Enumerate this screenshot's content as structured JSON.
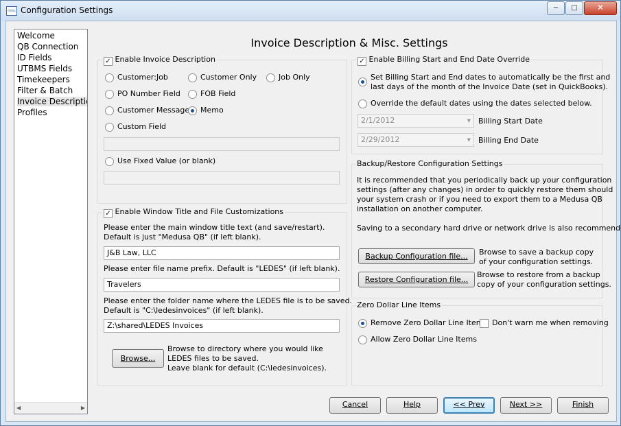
{
  "window": {
    "title": "Configuration Settings",
    "icon_text": "misc",
    "minimize": "−",
    "maximize": "□",
    "close": "✕"
  },
  "nav": {
    "items": [
      {
        "label": "Welcome"
      },
      {
        "label": "QB Connection"
      },
      {
        "label": "ID Fields"
      },
      {
        "label": "UTBMS Fields"
      },
      {
        "label": "Timekeepers"
      },
      {
        "label": "Filter & Batch"
      },
      {
        "label": "Invoice Description"
      },
      {
        "label": "Profiles"
      }
    ],
    "selected_index": 6,
    "scroll_left": "◀",
    "scroll_right": "▶"
  },
  "page_title": "Invoice Description & Misc. Settings",
  "invoice_desc": {
    "enable_label": "Enable Invoice Description",
    "enabled": true,
    "options": {
      "customer_job": "Customer:Job",
      "customer_only": "Customer Only",
      "job_only": "Job Only",
      "po_number": "PO Number Field",
      "fob": "FOB Field",
      "customer_message": "Customer Message",
      "memo": "Memo",
      "custom_field": "Custom Field",
      "fixed_value": "Use Fixed Value (or blank)"
    },
    "selected": "memo",
    "custom_field_value": "",
    "fixed_value": ""
  },
  "window_title": {
    "enable_label": "Enable Window Title and File Customizations",
    "enabled": true,
    "title_prompt_1": "Please enter the main window title text (and save/restart).",
    "title_prompt_2": "Default is just \"Medusa QB\" (if left blank).",
    "title_value": "J&B Law, LLC",
    "prefix_prompt": "Please enter file name prefix. Default is \"LEDES\" (if left blank).",
    "prefix_value": "Travelers",
    "folder_prompt_1": "Please enter the folder name where the LEDES file is to be saved.",
    "folder_prompt_2": "Default is \"C:\\ledesinvoices\" (if left blank).",
    "folder_value": "Z:\\shared\\LEDES Invoices",
    "browse_label": "Browse...",
    "browse_help_1": "Browse to directory where you would like",
    "browse_help_2": "LEDES files to be saved.",
    "browse_help_3": "Leave blank for default (C:\\ledesinvoices)."
  },
  "billing": {
    "enable_label": "Enable Billing Start and End Date Override",
    "enabled": true,
    "auto_label_1": "Set Billing Start and End dates to automatically be the first and",
    "auto_label_2": "last days of the month of the Invoice Date (set in QuickBooks).",
    "override_label": "Override the default dates using the dates selected below.",
    "selected": "auto",
    "start_value": "2/1/2012",
    "start_label": "Billing Start Date",
    "end_value": "2/29/2012",
    "end_label": "Billing End Date",
    "dropdown_arrow": "▼"
  },
  "backup": {
    "group_label": "Backup/Restore Configuration Settings",
    "text_1": "It is recommended that you periodically back up your configuration",
    "text_2": "settings (after any changes) in order to quickly restore them should",
    "text_3": "your system crash or if you need to export them to a Medusa QB",
    "text_4": "installation on another computer.",
    "text_5": "Saving to a secondary hard drive or network drive is also recommended.",
    "backup_button": "Backup Configuration file...",
    "backup_help_1": "Browse to save a backup copy",
    "backup_help_2": "of your configuration settings.",
    "restore_button": "Restore Configuration file...",
    "restore_help_1": "Browse to restore from a backup",
    "restore_help_2": "copy of your configuration settings."
  },
  "zero_dollar": {
    "group_label": "Zero Dollar Line Items",
    "remove_label": "Remove Zero Dollar Line Items",
    "allow_label": "Allow Zero Dollar Line Items",
    "selected": "remove",
    "dont_warn_label": "Don't warn me when removing",
    "dont_warn": false
  },
  "footer": {
    "cancel": "Cancel",
    "help": "Help",
    "prev": "<< Prev",
    "next": "Next >>",
    "finish": "Finish"
  },
  "check_mark": "✓"
}
